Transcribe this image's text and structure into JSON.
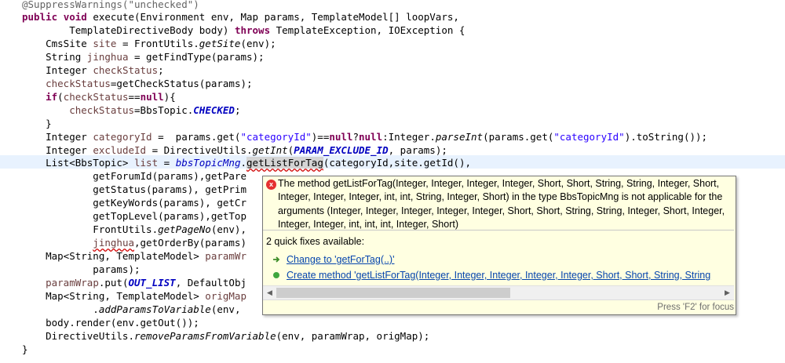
{
  "code": {
    "l1": "@SuppressWarnings(\"unchecked\")",
    "l2_kw1": "public",
    "l2_kw2": "void",
    "l2_rest": " execute(Environment env, Map params, TemplateModel[] loopVars,",
    "l3_a": "        TemplateDirectiveBody body) ",
    "l3_kw": "throws",
    "l3_b": " TemplateException, IOException {",
    "l4_a": "    CmsSite ",
    "l4_v": "site",
    "l4_b": " = FrontUtils.",
    "l4_m": "getSite",
    "l4_c": "(env);",
    "l5_a": "    String ",
    "l5_v": "jinghua",
    "l5_b": " = getFindType(params);",
    "l6_a": "    Integer ",
    "l6_v": "checkStatus",
    "l6_b": ";",
    "l7_v": "checkStatus",
    "l7_b": "=getCheckStatus(params);",
    "l8_kw": "if",
    "l8_a": "(",
    "l8_v": "checkStatus",
    "l8_b": "==",
    "l8_kw2": "null",
    "l8_c": "){",
    "l9_v": "checkStatus",
    "l9_b": "=BbsTopic.",
    "l9_f": "CHECKED",
    "l9_c": ";",
    "l10": "    }",
    "l11_a": "    Integer ",
    "l11_v": "categoryId",
    "l11_b": " =  params.get(",
    "l11_s": "\"categoryId\"",
    "l11_c": ")==",
    "l11_k1": "null",
    "l11_d": "?",
    "l11_k2": "null",
    "l11_e": ":Integer.",
    "l11_m": "parseInt",
    "l11_f": "(params.get(",
    "l11_s2": "\"categoryId\"",
    "l11_g": ").toString());",
    "l12_a": "    Integer ",
    "l12_v": "excludeId",
    "l12_b": " = DirectiveUtils.",
    "l12_m": "getInt",
    "l12_c": "(",
    "l12_f": "PARAM_EXCLUDE_ID",
    "l12_d": ", params);",
    "l13_a": "    List<BbsTopic> ",
    "l13_v": "list",
    "l13_b": " = ",
    "l13_fld": "bbsTopicMng",
    "l13_c": ".",
    "l13_err": "getListForTag",
    "l13_d": "(categoryId,site.getId(),",
    "l14": "            getForumId(params),getPare",
    "l15": "            getStatus(params), getPrim",
    "l16": "            getKeyWords(params), getCr",
    "l17": "            getTopLevel(params),getTop",
    "l18_a": "            FrontUtils.",
    "l18_m": "getPageNo",
    "l18_b": "(env),",
    "l19_a": "            ",
    "l19_v": "jinghua",
    "l19_b": ",getOrderBy(params)",
    "l20_a": "    Map<String, TemplateModel> ",
    "l20_v": "paramWr",
    "l21": "            params);",
    "l22_v": "paramWrap",
    "l22_a": ".put(",
    "l22_f": "OUT_LIST",
    "l22_b": ", DefaultObj",
    "l23_a": "    Map<String, TemplateModel> ",
    "l23_v": "origMap",
    "l24_a": "            .",
    "l24_m": "addParamsToVariable",
    "l24_b": "(env, ",
    "l25": "    body.render(env.getOut());",
    "l26_a": "    DirectiveUtils.",
    "l26_m": "removeParamsFromVariable",
    "l26_b": "(env, paramWrap, origMap);",
    "l27": "}"
  },
  "popup": {
    "error_icon_glyph": "x",
    "message": "The method getListForTag(Integer, Integer, Integer, Integer, Short, Short, String, String, Integer, Short, Integer, Integer, Integer, int, int, String, Integer, Short) in the type BbsTopicMng is not applicable for the arguments (Integer, Integer, Integer, Integer, Integer, Short, Short, String, String, Integer, Short, Integer, Integer, Integer, int, int, int, Integer, Short)",
    "quick_fixes_title": "2 quick fixes available:",
    "fixes": [
      {
        "label": "Change to 'getForTag(..)'",
        "icon": "change-arrow-icon"
      },
      {
        "label": "Create method 'getListForTag(Integer, Integer, Integer, Integer, Integer, Short, Short, String, String",
        "icon": "create-method-icon"
      }
    ],
    "footer": "Press 'F2' for focus"
  },
  "colors": {
    "keyword": "#7f0055",
    "string": "#2a00ff",
    "field": "#0000c0",
    "local_var": "#6a3e3e",
    "tooltip_bg": "#ffffe1",
    "line_highlight": "#e8f2fe"
  }
}
